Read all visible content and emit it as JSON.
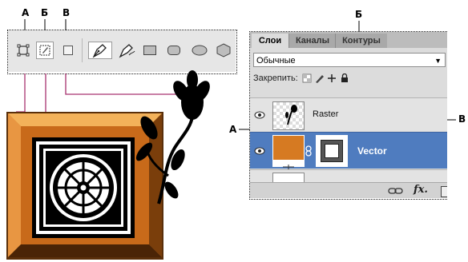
{
  "callouts": {
    "top_a": "А",
    "top_b": "Б",
    "top_v": "В",
    "panel_b": "Б",
    "right_v": "В",
    "left_a": "А"
  },
  "toolbar": {
    "tools": [
      {
        "name": "shape-layers-icon",
        "active": false
      },
      {
        "name": "paths-icon",
        "active": true
      },
      {
        "name": "fill-pixels-icon",
        "active": false
      },
      {
        "name": "pen-tool-icon",
        "active": true
      },
      {
        "name": "freeform-pen-tool-icon",
        "active": false
      },
      {
        "name": "rectangle-tool-icon",
        "active": false
      },
      {
        "name": "rounded-rectangle-tool-icon",
        "active": false
      },
      {
        "name": "ellipse-tool-icon",
        "active": false
      },
      {
        "name": "polygon-tool-icon",
        "active": false
      }
    ]
  },
  "panel": {
    "tabs": [
      {
        "label": "Слои",
        "active": true
      },
      {
        "label": "Каналы",
        "active": false
      },
      {
        "label": "Контуры",
        "active": false
      }
    ],
    "blend_mode": "Обычные",
    "lock_label": "Закрепить:",
    "layers": [
      {
        "name": "Raster",
        "selected": false
      },
      {
        "name": "Vector",
        "selected": true
      }
    ],
    "footer_icons": [
      "link-layers-icon",
      "fx-icon"
    ],
    "fx_label": "fx."
  },
  "colors": {
    "selection": "#4f7cbf",
    "tile_orange": "#d67a22",
    "callout_line": "#a8326f"
  }
}
